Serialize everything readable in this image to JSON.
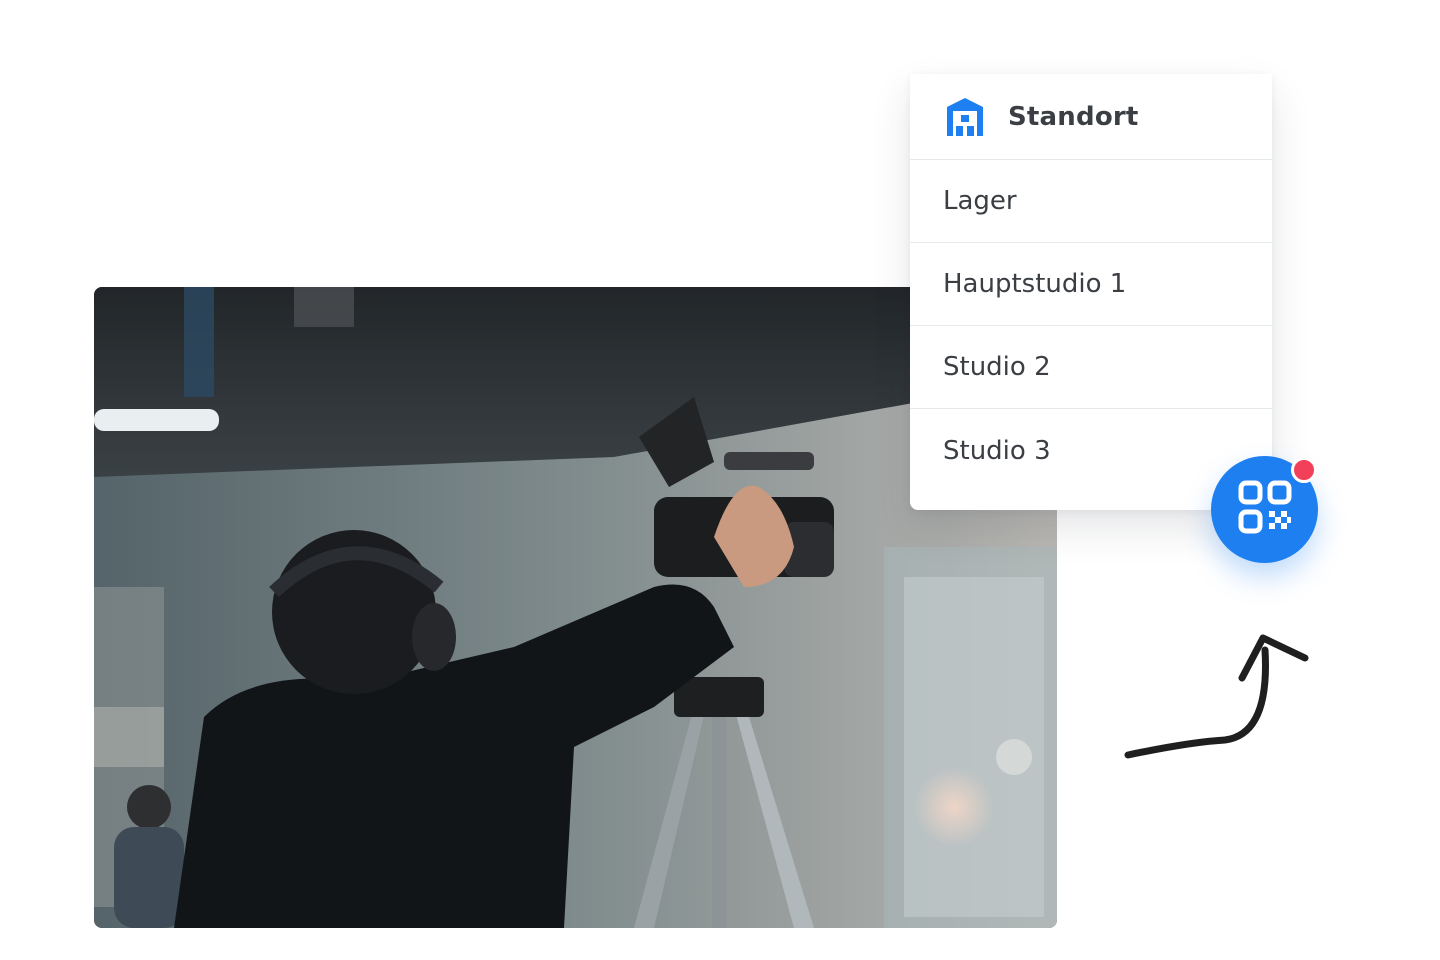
{
  "dropdown": {
    "header": {
      "title": "Standort",
      "icon": "building-icon"
    },
    "items": [
      {
        "label": "Lager"
      },
      {
        "label": "Hauptstudio 1"
      },
      {
        "label": "Studio 2"
      },
      {
        "label": "Studio 3"
      }
    ]
  },
  "qr_button": {
    "icon": "qr-code-icon",
    "has_notification": true
  },
  "colors": {
    "accent": "#1e7ff0",
    "badge": "#f2405a",
    "text": "#3b3f44",
    "divider": "#e6e8eb"
  },
  "photo": {
    "subject": "camera-operator-photo"
  }
}
